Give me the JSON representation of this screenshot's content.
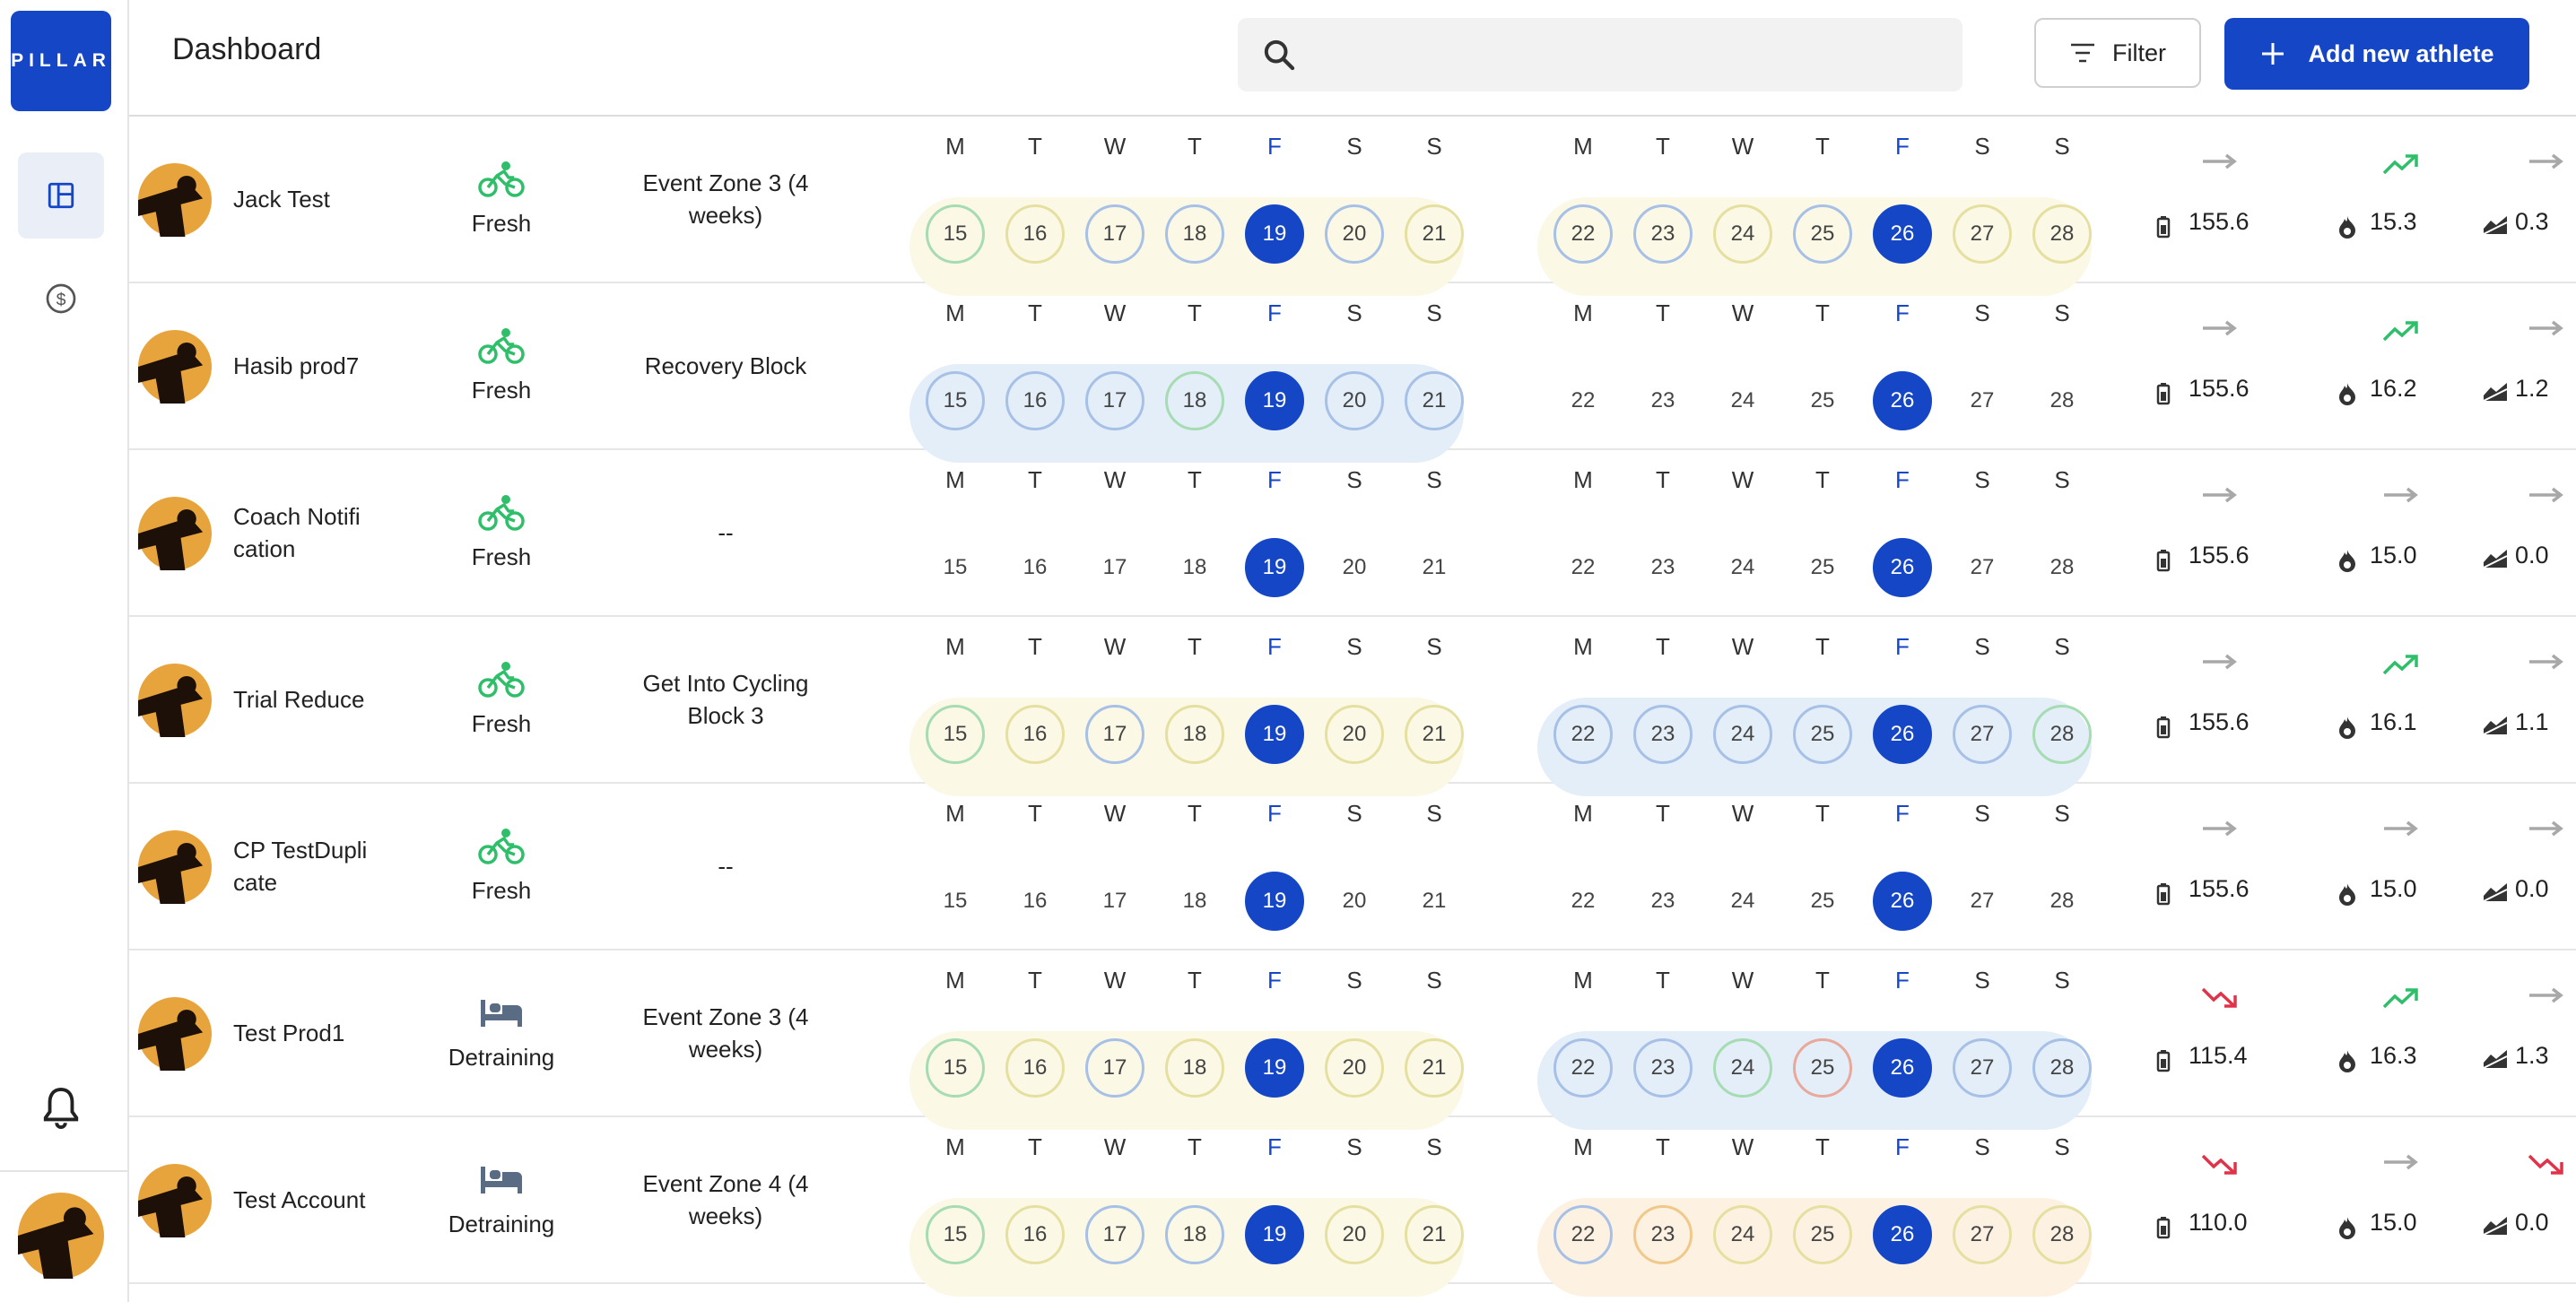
{
  "app": {
    "logo_text": "PILLAR"
  },
  "header": {
    "title": "Dashboard",
    "search_placeholder": "",
    "filter_label": "Filter",
    "add_label": "Add new athlete"
  },
  "colors": {
    "accent": "#1446c6",
    "green": "#2fbf6a",
    "red": "#e0334a",
    "gray": "#a8a8a8"
  },
  "week1_labels": [
    "M",
    "T",
    "W",
    "T",
    "F",
    "S",
    "S"
  ],
  "week2_labels": [
    "M",
    "T",
    "W",
    "T",
    "F",
    "S",
    "S"
  ],
  "today_index": 4,
  "athletes": [
    {
      "name": "Jack Test",
      "status": "Fresh",
      "status_icon": "bike-icon",
      "plan": "Event Zone 3 (4 weeks)",
      "week1": {
        "band": "yellow",
        "days": [
          [
            "15",
            "green"
          ],
          [
            "16",
            "yellow"
          ],
          [
            "17",
            "blue"
          ],
          [
            "18",
            "blue"
          ],
          [
            "19",
            "today"
          ],
          [
            "20",
            "blue"
          ],
          [
            "21",
            "yellow"
          ]
        ]
      },
      "week2": {
        "band": "yellow",
        "days": [
          [
            "22",
            "blue"
          ],
          [
            "23",
            "blue"
          ],
          [
            "24",
            "yellow"
          ],
          [
            "25",
            "blue"
          ],
          [
            "26",
            "yellow"
          ],
          [
            "27",
            "yellow"
          ],
          [
            "28",
            "yellow"
          ]
        ]
      },
      "metrics": [
        {
          "trend": "flat",
          "value": "155.6"
        },
        {
          "trend": "up",
          "value": "15.3"
        },
        {
          "trend": "flat",
          "value": "0.3"
        }
      ]
    },
    {
      "name": "Hasib prod7",
      "status": "Fresh",
      "status_icon": "bike-icon",
      "plan": "Recovery Block",
      "week1": {
        "band": "blue",
        "days": [
          [
            "15",
            "blue"
          ],
          [
            "16",
            "blue"
          ],
          [
            "17",
            "blue"
          ],
          [
            "18",
            "green"
          ],
          [
            "19",
            "today"
          ],
          [
            "20",
            "blue"
          ],
          [
            "21",
            "blue"
          ]
        ]
      },
      "week2": {
        "band": "none",
        "days": [
          [
            "22",
            ""
          ],
          [
            "23",
            ""
          ],
          [
            "24",
            ""
          ],
          [
            "25",
            ""
          ],
          [
            "26",
            ""
          ],
          [
            "27",
            ""
          ],
          [
            "28",
            ""
          ]
        ]
      },
      "metrics": [
        {
          "trend": "flat",
          "value": "155.6"
        },
        {
          "trend": "up",
          "value": "16.2"
        },
        {
          "trend": "flat",
          "value": "1.2"
        }
      ]
    },
    {
      "name": "Coach Notification",
      "status": "Fresh",
      "status_icon": "bike-icon",
      "plan": "--",
      "week1": {
        "band": "none",
        "days": [
          [
            "15",
            ""
          ],
          [
            "16",
            ""
          ],
          [
            "17",
            ""
          ],
          [
            "18",
            ""
          ],
          [
            "19",
            "today"
          ],
          [
            "20",
            ""
          ],
          [
            "21",
            ""
          ]
        ]
      },
      "week2": {
        "band": "none",
        "days": [
          [
            "22",
            ""
          ],
          [
            "23",
            ""
          ],
          [
            "24",
            ""
          ],
          [
            "25",
            ""
          ],
          [
            "26",
            ""
          ],
          [
            "27",
            ""
          ],
          [
            "28",
            ""
          ]
        ]
      },
      "metrics": [
        {
          "trend": "flat",
          "value": "155.6"
        },
        {
          "trend": "flat",
          "value": "15.0"
        },
        {
          "trend": "flat",
          "value": "0.0"
        }
      ]
    },
    {
      "name": "Trial Reduce",
      "status": "Fresh",
      "status_icon": "bike-icon",
      "plan": "Get Into Cycling Block 3",
      "week1": {
        "band": "yellow",
        "days": [
          [
            "15",
            "green"
          ],
          [
            "16",
            "yellow"
          ],
          [
            "17",
            "blue"
          ],
          [
            "18",
            "yellow"
          ],
          [
            "19",
            "today"
          ],
          [
            "20",
            "yellow"
          ],
          [
            "21",
            "yellow"
          ]
        ]
      },
      "week2": {
        "band": "blue",
        "days": [
          [
            "22",
            "blue"
          ],
          [
            "23",
            "blue"
          ],
          [
            "24",
            "blue"
          ],
          [
            "25",
            "blue"
          ],
          [
            "26",
            "green"
          ],
          [
            "27",
            "blue"
          ],
          [
            "28",
            "green"
          ]
        ]
      },
      "metrics": [
        {
          "trend": "flat",
          "value": "155.6"
        },
        {
          "trend": "up",
          "value": "16.1"
        },
        {
          "trend": "flat",
          "value": "1.1"
        }
      ]
    },
    {
      "name": "CP TestDuplicate",
      "status": "Fresh",
      "status_icon": "bike-icon",
      "plan": "--",
      "week1": {
        "band": "none",
        "days": [
          [
            "15",
            ""
          ],
          [
            "16",
            ""
          ],
          [
            "17",
            ""
          ],
          [
            "18",
            ""
          ],
          [
            "19",
            "today"
          ],
          [
            "20",
            ""
          ],
          [
            "21",
            ""
          ]
        ]
      },
      "week2": {
        "band": "none",
        "days": [
          [
            "22",
            ""
          ],
          [
            "23",
            ""
          ],
          [
            "24",
            ""
          ],
          [
            "25",
            ""
          ],
          [
            "26",
            ""
          ],
          [
            "27",
            ""
          ],
          [
            "28",
            ""
          ]
        ]
      },
      "metrics": [
        {
          "trend": "flat",
          "value": "155.6"
        },
        {
          "trend": "flat",
          "value": "15.0"
        },
        {
          "trend": "flat",
          "value": "0.0"
        }
      ]
    },
    {
      "name": "Test Prod1",
      "status": "Detraining",
      "status_icon": "bed-icon",
      "plan": "Event Zone 3 (4 weeks)",
      "week1": {
        "band": "yellow",
        "days": [
          [
            "15",
            "green"
          ],
          [
            "16",
            "yellow"
          ],
          [
            "17",
            "blue"
          ],
          [
            "18",
            "yellow"
          ],
          [
            "19",
            "today"
          ],
          [
            "20",
            "yellow"
          ],
          [
            "21",
            "yellow"
          ]
        ]
      },
      "week2": {
        "band": "blue",
        "days": [
          [
            "22",
            "blue"
          ],
          [
            "23",
            "blue"
          ],
          [
            "24",
            "green"
          ],
          [
            "25",
            "red"
          ],
          [
            "26",
            "blue"
          ],
          [
            "27",
            "blue"
          ],
          [
            "28",
            "blue"
          ]
        ]
      },
      "metrics": [
        {
          "trend": "down",
          "value": "115.4"
        },
        {
          "trend": "up",
          "value": "16.3"
        },
        {
          "trend": "flat",
          "value": "1.3"
        }
      ]
    },
    {
      "name": "Test Account",
      "status": "Detraining",
      "status_icon": "bed-icon",
      "plan": "Event Zone 4 (4 weeks)",
      "week1": {
        "band": "yellow",
        "days": [
          [
            "15",
            "green"
          ],
          [
            "16",
            "yellow"
          ],
          [
            "17",
            "blue"
          ],
          [
            "18",
            "blue"
          ],
          [
            "19",
            "today"
          ],
          [
            "20",
            "yellow"
          ],
          [
            "21",
            "yellow"
          ]
        ]
      },
      "week2": {
        "band": "orange",
        "days": [
          [
            "22",
            "blue"
          ],
          [
            "23",
            "orange"
          ],
          [
            "24",
            "yellow"
          ],
          [
            "25",
            "yellow"
          ],
          [
            "26",
            "orange"
          ],
          [
            "27",
            "yellow"
          ],
          [
            "28",
            "yellow"
          ]
        ]
      },
      "metrics": [
        {
          "trend": "down",
          "value": "110.0"
        },
        {
          "trend": "flat",
          "value": "15.0"
        },
        {
          "trend": "down",
          "value": "0.0"
        }
      ]
    }
  ]
}
